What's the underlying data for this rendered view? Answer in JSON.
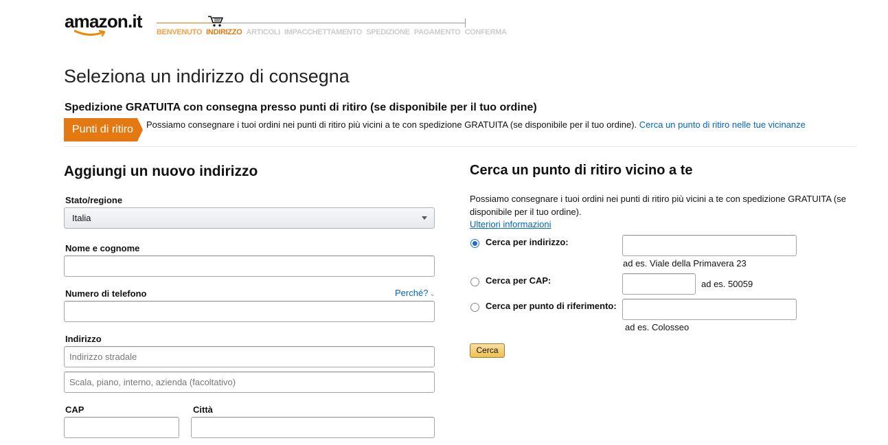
{
  "header": {
    "logo_text": "amazon.it",
    "steps": [
      {
        "label": "BENVENUTO",
        "state": "done"
      },
      {
        "label": "INDIRIZZO",
        "state": "current"
      },
      {
        "label": "ARTICOLI",
        "state": "todo"
      },
      {
        "label": "IMPACCHETTAMENTO",
        "state": "todo"
      },
      {
        "label": "SPEDIZIONE",
        "state": "todo"
      },
      {
        "label": "PAGAMENTO",
        "state": "todo"
      },
      {
        "label": "CONFERMA",
        "state": "todo"
      }
    ]
  },
  "page_title": "Seleziona un indirizzo di consegna",
  "pickup": {
    "heading": "Spedizione GRATUITA con consegna presso punti di ritiro (se disponibile per il tuo ordine)",
    "badge": "Punti di ritiro",
    "description": "Possiamo consegnare i tuoi ordini nei punti di ritiro più vicini a te con spedizione GRATUITA (se disponibile per il tuo ordine).",
    "link": "Cerca un punto di ritiro nelle tue vicinanze"
  },
  "new_address": {
    "title": "Aggiungi un nuovo indirizzo",
    "country_label": "Stato/regione",
    "country_value": "Italia",
    "name_label": "Nome e cognome",
    "name_value": "",
    "phone_label": "Numero di telefono",
    "phone_why": "Perché?",
    "phone_value": "",
    "address_label": "Indirizzo",
    "address1_placeholder": "Indirizzo stradale",
    "address2_placeholder": "Scala, piano, interno, azienda (facoltativo)",
    "cap_label": "CAP",
    "city_label": "Città"
  },
  "pickup_search": {
    "title": "Cerca un punto di ritiro vicino a te",
    "description": "Possiamo consegnare i tuoi ordini nei punti di ritiro più vicini a te con spedizione GRATUITA (se disponibile per il tuo ordine).",
    "more_info": "Ulteriori informazioni",
    "options": [
      {
        "label": "Cerca per indirizzo:",
        "hint": "ad es. Viale della Primavera 23",
        "selected": true
      },
      {
        "label": "Cerca per CAP:",
        "hint": "ad es. 50059",
        "selected": false
      },
      {
        "label": "Cerca per punto di riferimento:",
        "hint": "ad es. Colosseo",
        "selected": false
      }
    ],
    "button": "Cerca"
  },
  "colors": {
    "accent_orange": "#e47911",
    "link_blue": "#0066c0",
    "button_gold": "#f0c14b"
  }
}
